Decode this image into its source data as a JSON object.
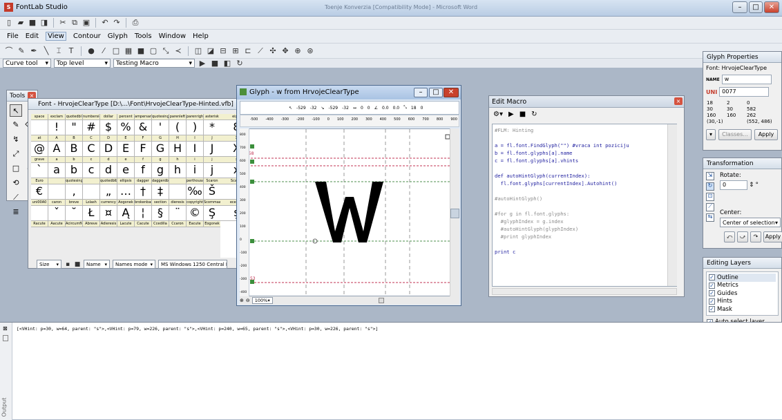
{
  "app": {
    "title": "FontLab Studio",
    "word_title": "Toenje  Konverzia [Compatibility Mode] - Microsoft Word"
  },
  "menu": [
    "File",
    "Edit",
    "View",
    "Contour",
    "Glyph",
    "Tools",
    "Window",
    "Help"
  ],
  "toolbar3": {
    "tool": "Curve tool",
    "level": "Top level",
    "macro": "Testing Macro"
  },
  "tools_panel": {
    "title": "Tools"
  },
  "font_window": {
    "title": "Font - HrvojeClearType [D:\\...\\Font\\HrvojeClearType-Hinted.vfb]",
    "headers": [
      "space",
      "exclam",
      "quotedbl",
      "numbersign",
      "dollar",
      "percent",
      "ampersand",
      "quotesingle",
      "parenleft",
      "parenright",
      "asterisk"
    ],
    "row1": [
      "",
      "!",
      "\"",
      "#",
      "$",
      "%",
      "&",
      "'",
      "(",
      ")",
      "*"
    ],
    "headers2": [
      "at",
      "A",
      "B",
      "C",
      "D",
      "E",
      "F",
      "G",
      "H",
      "I",
      "J"
    ],
    "row2": [
      "@",
      "A",
      "B",
      "C",
      "D",
      "E",
      "F",
      "G",
      "H",
      "I",
      "J"
    ],
    "headers3": [
      "grave",
      "a",
      "b",
      "c",
      "d",
      "e",
      "f",
      "g",
      "h",
      "i",
      "j"
    ],
    "row3": [
      "`",
      "a",
      "b",
      "c",
      "d",
      "e",
      "f",
      "g",
      "h",
      "i",
      "j"
    ],
    "headers4": [
      "Euro",
      "",
      "quotesinglbase",
      "",
      "quotedblbase",
      "ellipsis",
      "dagger",
      "daggerdbl",
      "",
      "perthousand",
      "Scaron"
    ],
    "row4": [
      "€",
      "",
      "‚",
      "",
      "„",
      "…",
      "†",
      "‡",
      "",
      "‰",
      "Š"
    ],
    "headers5": [
      "uni00A0",
      "caron",
      "breve",
      "Lslash",
      "currency",
      "Aogonek",
      "brokenbar",
      "section",
      "dieresis",
      "copyright",
      "Scommaaccent"
    ],
    "row5": [
      "",
      "ˇ",
      "˘",
      "Ł",
      "¤",
      "Ą",
      "¦",
      "§",
      "¨",
      "©",
      "Ş"
    ],
    "headers6": [
      "Racute",
      "Aacute",
      "Acircumflex",
      "Abreve",
      "Adieresis",
      "Lacute",
      "Cacute",
      "Ccedilla",
      "Ccaron",
      "Eacute",
      "Eogonek"
    ],
    "right_headers": [
      "eight",
      "X",
      "x",
      "Scaron",
      "ecedilla"
    ],
    "right_row": [
      "8",
      "X",
      "x",
      "",
      "ş"
    ],
    "footer": {
      "size": "Size",
      "name": "Name",
      "mode": "Names mode",
      "codepage": "MS Windows 1250 Central Euro..."
    }
  },
  "glyph_window": {
    "title": "Glyph - w from HrvojeClearType",
    "glyph": "W",
    "zoom": "100%",
    "coords": [
      "-529",
      "-32",
      "-529",
      "-32",
      "0",
      "0",
      "0.0",
      "0.0",
      "18",
      "0"
    ],
    "ruler": [
      "-500",
      "-400",
      "-300",
      "-200",
      "-100",
      "0",
      "100",
      "200",
      "300",
      "400",
      "500",
      "600",
      "700",
      "800",
      "900"
    ],
    "vruler": [
      "800",
      "700",
      "600",
      "500",
      "400",
      "300",
      "200",
      "100",
      "0",
      "-100",
      "-200",
      "-300",
      "-400"
    ],
    "marks": {
      "top": "658",
      "bottom": "-153"
    }
  },
  "macro": {
    "title": "Edit Macro",
    "lines": [
      {
        "t": "#FLM: Hinting",
        "c": true
      },
      {
        "t": "",
        "c": false
      },
      {
        "t": "a = fl.font.FindGlyph(\"\") #vraca int poziciju",
        "c": false
      },
      {
        "t": "b = fl.font.glyphs[a].name",
        "c": false
      },
      {
        "t": "c = fl.font.glyphs[a].vhints",
        "c": false
      },
      {
        "t": "",
        "c": false
      },
      {
        "t": "def autoHintGlyph(currentIndex):",
        "c": false
      },
      {
        "t": "  fl.font.glyphs[currentIndex].Autohint()",
        "c": false
      },
      {
        "t": "",
        "c": false
      },
      {
        "t": "#autoHintGlyph()",
        "c": true
      },
      {
        "t": "",
        "c": false
      },
      {
        "t": "#for g in fl.font.glyphs:",
        "c": true
      },
      {
        "t": "  #glyphIndex = g.index",
        "c": true
      },
      {
        "t": "  #autoHintGlyph(glyphIndex)",
        "c": true
      },
      {
        "t": "  #print glyphIndex",
        "c": true
      },
      {
        "t": "",
        "c": false
      },
      {
        "t": "print c",
        "c": false
      }
    ]
  },
  "glyph_props": {
    "title": "Glyph Properties",
    "font": "Font: HrvojeClearType",
    "name_label": "NAME",
    "name": "w",
    "unicode": "0077",
    "metrics": [
      "18",
      "2",
      "0",
      "30",
      "30",
      "582",
      "160",
      "160",
      "262",
      "(30,-1)",
      "(552, 486)"
    ],
    "classes": "Classes...",
    "apply": "Apply"
  },
  "transformation": {
    "title": "Transformation",
    "rotate": "Rotate:",
    "angle": "0",
    "deg": "°",
    "center": "Center:",
    "center_value": "Center of selection",
    "apply": "Apply"
  },
  "layers": {
    "title": "Editing Layers",
    "items": [
      "Outline",
      "Metrics",
      "Guides",
      "Hints",
      "Mask"
    ],
    "auto": "Auto select layer"
  },
  "output": {
    "label": "Output",
    "text": "[<VHint: p=30, w=64, parent: \"s\">,<VHint: p=79, w=226, parent: \"s\">,<VHint: p=240, w=65, parent: \"s\">,<VHint: p=30, w=226, parent: \"s\">]"
  }
}
